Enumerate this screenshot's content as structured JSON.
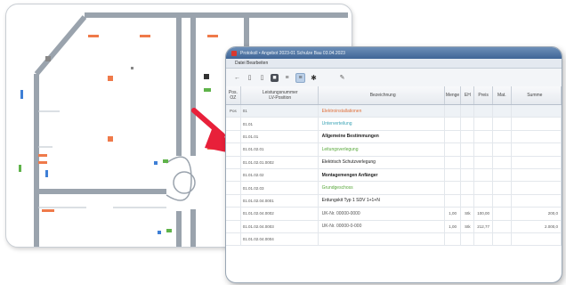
{
  "window": {
    "title": "Protokoll • Angebot 2023-01 Schulze Bau 03.04.2023",
    "menu": "Datei  Bearbeiten",
    "toolbar_icons": [
      "arrow-left-icon",
      "save-icon",
      "copy-icon",
      "print-icon",
      "list-icon",
      "list-selected-icon",
      "gear-icon",
      "marker-icon"
    ]
  },
  "columns": {
    "pos": "Pos.\nOZ",
    "kurz": "Leistungsnummer\nLV-Position",
    "bez": "Bezeichnung",
    "menge": "Menge",
    "eh": "EH",
    "preis": "Preis",
    "mat": "Mat.",
    "summe": "Summe"
  },
  "rows": [
    {
      "pos": "Pos",
      "kurz": "01",
      "bez": "Elektroinstallationen",
      "style": "orange",
      "menge": "",
      "eh": "",
      "preis": "",
      "mat": "",
      "summe": ""
    },
    {
      "pos": "",
      "kurz": "01.01",
      "bez": "Unterverteilung",
      "style": "teal",
      "menge": "",
      "eh": "",
      "preis": "",
      "mat": "",
      "summe": ""
    },
    {
      "pos": "",
      "kurz": "01.01.01",
      "bez": "Allgemeine Bestimmungen",
      "style": "dark",
      "menge": "",
      "eh": "",
      "preis": "",
      "mat": "",
      "summe": ""
    },
    {
      "pos": "",
      "kurz": "01.01.02.01",
      "bez": "Leitungsverlegung",
      "style": "green",
      "menge": "",
      "eh": "",
      "preis": "",
      "mat": "",
      "summe": ""
    },
    {
      "pos": "",
      "kurz": "01.01.02.01.0002",
      "bez": "Elektrisch Schutzverlegung",
      "style": "dark-plain",
      "menge": "",
      "eh": "",
      "preis": "",
      "mat": "",
      "summe": ""
    },
    {
      "pos": "",
      "kurz": "01.01.02.02",
      "bez": "Montagemengen Anfänger",
      "style": "dark",
      "menge": "",
      "eh": "",
      "preis": "",
      "mat": "",
      "summe": ""
    },
    {
      "pos": "",
      "kurz": "01.01.02.03",
      "bez": "Grundgeschoss",
      "style": "green",
      "menge": "",
      "eh": "",
      "preis": "",
      "mat": "",
      "summe": ""
    },
    {
      "pos": "",
      "kurz": "01.01.02.04.0001",
      "bez": "Erdungskit Typ 1 SDV 1+1+N",
      "style": "dark-plain",
      "menge": "",
      "eh": "",
      "preis": "",
      "mat": "",
      "summe": ""
    },
    {
      "pos": "",
      "kurz": "01.01.02.04.0002",
      "bez": "UK-Nr. 00000-0000",
      "style": "plain",
      "menge": "1,00",
      "eh": "Stk",
      "preis": "100,00",
      "mat": "",
      "summe": "200,0"
    },
    {
      "pos": "",
      "kurz": "01.01.02.04.0003",
      "bez": "UK-Nr. 00000-0-000",
      "style": "plain",
      "menge": "1,00",
      "eh": "Stk",
      "preis": "212,77",
      "mat": "",
      "summe": "2.000,0"
    },
    {
      "pos": "",
      "kurz": "01.01.02.04.0004",
      "bez": "",
      "style": "plain",
      "menge": "",
      "eh": "",
      "preis": "",
      "mat": "",
      "summe": ""
    }
  ],
  "colors": {
    "titlebar": "#3f6596",
    "arrow": "#e8203a",
    "orange": "#e0703a",
    "teal": "#3aa3b5",
    "green": "#58a83b"
  }
}
